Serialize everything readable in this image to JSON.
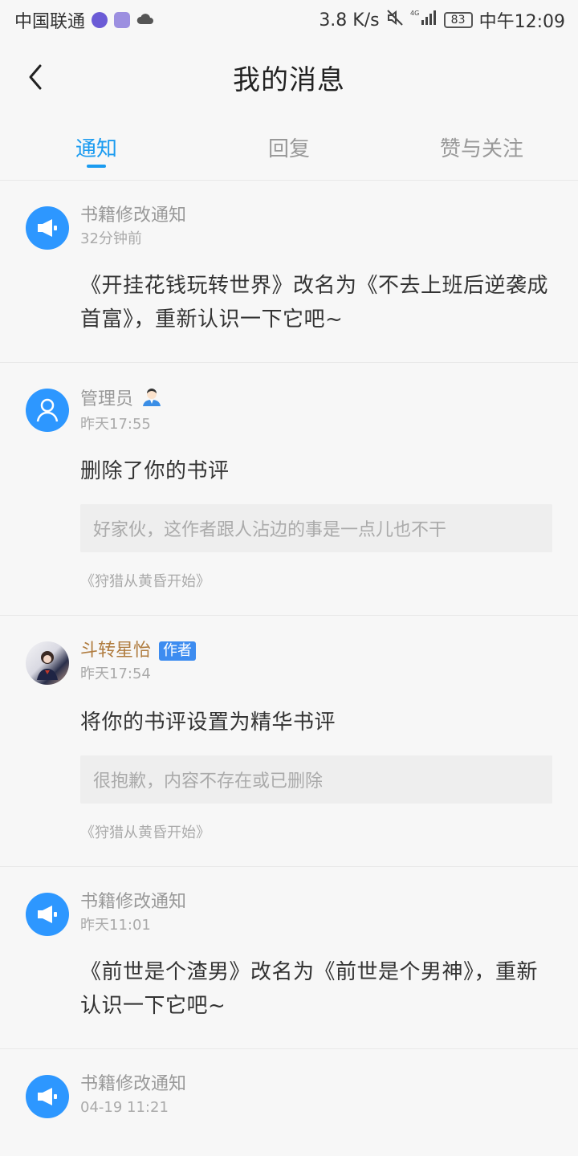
{
  "status_bar": {
    "carrier": "中国联通",
    "speed": "3.8 K/s",
    "network": "4G",
    "battery": "83",
    "time": "中午12:09"
  },
  "header": {
    "title": "我的消息"
  },
  "tabs": [
    {
      "label": "通知",
      "active": true
    },
    {
      "label": "回复",
      "active": false
    },
    {
      "label": "赞与关注",
      "active": false
    }
  ],
  "messages": [
    {
      "type": "notice",
      "sender": "书籍修改通知",
      "time": "32分钟前",
      "text": "《开挂花钱玩转世界》改名为《不去上班后逆袭成首富》，重新认识一下它吧~"
    },
    {
      "type": "admin",
      "sender": "管理员",
      "time": "昨天17:55",
      "text": "删除了你的书评",
      "quote": "好家伙，这作者跟人沾边的事是一点儿也不干",
      "book": "《狩猎从黄昏开始》"
    },
    {
      "type": "author",
      "sender": "斗转星怡",
      "badge": "作者",
      "time": "昨天17:54",
      "text": "将你的书评设置为精华书评",
      "quote": "很抱歉，内容不存在或已删除",
      "book": "《狩猎从黄昏开始》"
    },
    {
      "type": "notice",
      "sender": "书籍修改通知",
      "time": "昨天11:01",
      "text": "《前世是个渣男》改名为《前世是个男神》，重新认识一下它吧~"
    },
    {
      "type": "notice",
      "sender": "书籍修改通知",
      "time": "04-19 11:21"
    }
  ],
  "colors": {
    "accent": "#1a9bf0",
    "avatar_blue": "#2d97ff",
    "badge_blue": "#3d8cf0",
    "author_name": "#b07c3f"
  }
}
